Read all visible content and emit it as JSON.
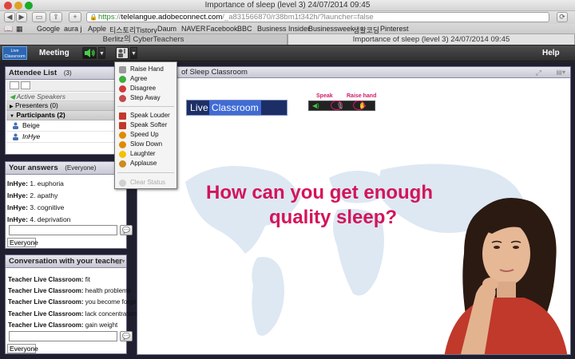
{
  "browser": {
    "window_title": "Importance of sleep (level 3) 24/07/2014 09:45",
    "url_scheme": "https",
    "url_host": "telelangue.adobeconnect.com",
    "url_path": "/_a831566870/r38bm1t342h/?launcher=false",
    "tabs": [
      {
        "label": "Berlitz의 CyberTeachers"
      },
      {
        "label": "Importance of sleep (level 3) 24/07/2014 09:45"
      }
    ],
    "bookmarks": [
      "Google",
      "aura j",
      "Apple",
      "티스토리Tistory",
      "Daum",
      "NAVER",
      "Facebook",
      "BBC",
      "Business Insider",
      "Businessweek",
      "생활코딩",
      "Pinterest"
    ]
  },
  "connect": {
    "logo_line1": "Live",
    "logo_line2": "Classroom",
    "menu_meeting": "Meeting",
    "menu_help": "Help"
  },
  "status_menu": {
    "items": [
      {
        "label": "Raise Hand",
        "icon": "raise-hand-icon",
        "color": "#888888"
      },
      {
        "label": "Agree",
        "icon": "agree-icon",
        "color": "#3fae3f"
      },
      {
        "label": "Disagree",
        "icon": "disagree-icon",
        "color": "#d23a3a"
      },
      {
        "label": "Step Away",
        "icon": "step-away-icon",
        "color": "#c44a4a"
      },
      {
        "label": "Speak Louder",
        "icon": "speak-louder-icon",
        "color": "#c0392b"
      },
      {
        "label": "Speak Softer",
        "icon": "speak-softer-icon",
        "color": "#c0392b"
      },
      {
        "label": "Speed Up",
        "icon": "speed-up-icon",
        "color": "#e08a00"
      },
      {
        "label": "Slow Down",
        "icon": "slow-down-icon",
        "color": "#e08a00"
      },
      {
        "label": "Laughter",
        "icon": "laughter-icon",
        "color": "#f2c200"
      },
      {
        "label": "Applause",
        "icon": "applause-icon",
        "color": "#d08a1a"
      }
    ],
    "clear_label": "Clear Status"
  },
  "attendee_pod": {
    "title": "Attendee List",
    "count": "(3)",
    "active_speakers": "Active Speakers",
    "presenters": "Presenters (0)",
    "participants": "Participants (2)",
    "people": [
      "Beige",
      "InHye"
    ]
  },
  "answers_pod": {
    "title": "Your answers",
    "audience": "(Everyone)",
    "answers": [
      {
        "name": "InHye:",
        "text": "1. euphoria"
      },
      {
        "name": "InHye:",
        "text": "2. apathy"
      },
      {
        "name": "InHye:",
        "text": "3. cognitive"
      },
      {
        "name": "InHye:",
        "text": "4. deprivation"
      }
    ],
    "recipient": "Everyone"
  },
  "conversation_pod": {
    "title": "Conversation with your teacher",
    "messages": [
      {
        "name": "Teacher Live Classroom:",
        "text": "fit"
      },
      {
        "name": "Teacher Live Classroom:",
        "text": "health problems"
      },
      {
        "name": "Teacher Live Classroom:",
        "text": "you become forgetful"
      },
      {
        "name": "Teacher Live Classroom:",
        "text": "lack concentration"
      },
      {
        "name": "Teacher Live Classroom:",
        "text": "gain weight"
      }
    ],
    "recipient": "Everyone"
  },
  "share_pod": {
    "title_suffix": "of Sleep Classroom",
    "logo_live": "Live",
    "logo_classroom": "Classroom",
    "speak_label": "Speak",
    "raise_hand_label": "Raise hand",
    "question_line1": "How can you get enough",
    "question_line2": "quality sleep?"
  },
  "colors": {
    "accent_pink": "#d4145a",
    "connect_blue": "#2b67b5"
  }
}
